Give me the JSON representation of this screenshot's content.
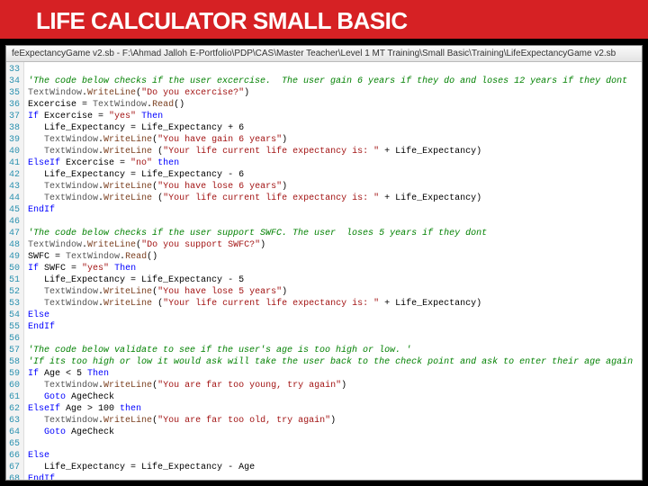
{
  "title": "LIFE CALCULATOR SMALL BASIC",
  "window_title": "feExpectancyGame v2.sb - F:\\Ahmad Jalloh E-Portfolio\\PDP\\CAS\\Master Teacher\\Level 1 MT Training\\Small Basic\\Training\\LifeExpectancyGame v2.sb",
  "lines": [
    {
      "n": "33",
      "t": []
    },
    {
      "n": "34",
      "t": [
        {
          "c": "tok-com",
          "v": "'The code below checks if the user excercise.  The user gain 6 years if they do and loses 12 years if they dont"
        }
      ]
    },
    {
      "n": "35",
      "t": [
        {
          "c": "tok-obj",
          "v": "TextWindow"
        },
        {
          "c": "tok-op",
          "v": "."
        },
        {
          "c": "tok-meth",
          "v": "WriteLine"
        },
        {
          "c": "tok-op",
          "v": "("
        },
        {
          "c": "tok-str",
          "v": "\"Do you excercise?\""
        },
        {
          "c": "tok-op",
          "v": ")"
        }
      ]
    },
    {
      "n": "36",
      "t": [
        {
          "c": "tok-var",
          "v": "Excercise "
        },
        {
          "c": "tok-op",
          "v": "= "
        },
        {
          "c": "tok-obj",
          "v": "TextWindow"
        },
        {
          "c": "tok-op",
          "v": "."
        },
        {
          "c": "tok-meth",
          "v": "Read"
        },
        {
          "c": "tok-op",
          "v": "()"
        }
      ]
    },
    {
      "n": "37",
      "t": [
        {
          "c": "tok-kw",
          "v": "If "
        },
        {
          "c": "tok-var",
          "v": "Excercise "
        },
        {
          "c": "tok-op",
          "v": "= "
        },
        {
          "c": "tok-str",
          "v": "\"yes\" "
        },
        {
          "c": "tok-kw",
          "v": "Then"
        }
      ]
    },
    {
      "n": "38",
      "t": [
        {
          "c": "tok-op",
          "v": "   "
        },
        {
          "c": "tok-var",
          "v": "Life_Expectancy "
        },
        {
          "c": "tok-op",
          "v": "= "
        },
        {
          "c": "tok-var",
          "v": "Life_Expectancy "
        },
        {
          "c": "tok-op",
          "v": "+ 6"
        }
      ]
    },
    {
      "n": "39",
      "t": [
        {
          "c": "tok-op",
          "v": "   "
        },
        {
          "c": "tok-obj",
          "v": "TextWindow"
        },
        {
          "c": "tok-op",
          "v": "."
        },
        {
          "c": "tok-meth",
          "v": "WriteLine"
        },
        {
          "c": "tok-op",
          "v": "("
        },
        {
          "c": "tok-str",
          "v": "\"You have gain 6 years\""
        },
        {
          "c": "tok-op",
          "v": ")"
        }
      ]
    },
    {
      "n": "40",
      "t": [
        {
          "c": "tok-op",
          "v": "   "
        },
        {
          "c": "tok-obj",
          "v": "TextWindow"
        },
        {
          "c": "tok-op",
          "v": "."
        },
        {
          "c": "tok-meth",
          "v": "WriteLine "
        },
        {
          "c": "tok-op",
          "v": "("
        },
        {
          "c": "tok-str",
          "v": "\"Your life current life expectancy is: \" "
        },
        {
          "c": "tok-op",
          "v": "+ "
        },
        {
          "c": "tok-var",
          "v": "Life_Expectancy"
        },
        {
          "c": "tok-op",
          "v": ")"
        }
      ]
    },
    {
      "n": "41",
      "t": [
        {
          "c": "tok-kw",
          "v": "ElseIf "
        },
        {
          "c": "tok-var",
          "v": "Excercise "
        },
        {
          "c": "tok-op",
          "v": "= "
        },
        {
          "c": "tok-str",
          "v": "\"no\" "
        },
        {
          "c": "tok-kw",
          "v": "then"
        }
      ]
    },
    {
      "n": "42",
      "t": [
        {
          "c": "tok-op",
          "v": "   "
        },
        {
          "c": "tok-var",
          "v": "Life_Expectancy "
        },
        {
          "c": "tok-op",
          "v": "= "
        },
        {
          "c": "tok-var",
          "v": "Life_Expectancy "
        },
        {
          "c": "tok-op",
          "v": "- 6"
        }
      ]
    },
    {
      "n": "43",
      "t": [
        {
          "c": "tok-op",
          "v": "   "
        },
        {
          "c": "tok-obj",
          "v": "TextWindow"
        },
        {
          "c": "tok-op",
          "v": "."
        },
        {
          "c": "tok-meth",
          "v": "WriteLine"
        },
        {
          "c": "tok-op",
          "v": "("
        },
        {
          "c": "tok-str",
          "v": "\"You have lose 6 years\""
        },
        {
          "c": "tok-op",
          "v": ")"
        }
      ]
    },
    {
      "n": "44",
      "t": [
        {
          "c": "tok-op",
          "v": "   "
        },
        {
          "c": "tok-obj",
          "v": "TextWindow"
        },
        {
          "c": "tok-op",
          "v": "."
        },
        {
          "c": "tok-meth",
          "v": "WriteLine "
        },
        {
          "c": "tok-op",
          "v": "("
        },
        {
          "c": "tok-str",
          "v": "\"Your life current life expectancy is: \" "
        },
        {
          "c": "tok-op",
          "v": "+ "
        },
        {
          "c": "tok-var",
          "v": "Life_Expectancy"
        },
        {
          "c": "tok-op",
          "v": ")"
        }
      ]
    },
    {
      "n": "45",
      "t": [
        {
          "c": "tok-kw",
          "v": "EndIf"
        }
      ]
    },
    {
      "n": "46",
      "t": []
    },
    {
      "n": "47",
      "t": [
        {
          "c": "tok-com",
          "v": "'The code below checks if the user support SWFC. The user  loses 5 years if they dont"
        }
      ]
    },
    {
      "n": "48",
      "t": [
        {
          "c": "tok-obj",
          "v": "TextWindow"
        },
        {
          "c": "tok-op",
          "v": "."
        },
        {
          "c": "tok-meth",
          "v": "WriteLine"
        },
        {
          "c": "tok-op",
          "v": "("
        },
        {
          "c": "tok-str",
          "v": "\"Do you support SWFC?\""
        },
        {
          "c": "tok-op",
          "v": ")"
        }
      ]
    },
    {
      "n": "49",
      "t": [
        {
          "c": "tok-var",
          "v": "SWFC "
        },
        {
          "c": "tok-op",
          "v": "= "
        },
        {
          "c": "tok-obj",
          "v": "TextWindow"
        },
        {
          "c": "tok-op",
          "v": "."
        },
        {
          "c": "tok-meth",
          "v": "Read"
        },
        {
          "c": "tok-op",
          "v": "()"
        }
      ]
    },
    {
      "n": "50",
      "t": [
        {
          "c": "tok-kw",
          "v": "If "
        },
        {
          "c": "tok-var",
          "v": "SWFC "
        },
        {
          "c": "tok-op",
          "v": "= "
        },
        {
          "c": "tok-str",
          "v": "\"yes\" "
        },
        {
          "c": "tok-kw",
          "v": "Then"
        }
      ]
    },
    {
      "n": "51",
      "t": [
        {
          "c": "tok-op",
          "v": "   "
        },
        {
          "c": "tok-var",
          "v": "Life_Expectancy "
        },
        {
          "c": "tok-op",
          "v": "= "
        },
        {
          "c": "tok-var",
          "v": "Life_Expectancy "
        },
        {
          "c": "tok-op",
          "v": "- 5"
        }
      ]
    },
    {
      "n": "52",
      "t": [
        {
          "c": "tok-op",
          "v": "   "
        },
        {
          "c": "tok-obj",
          "v": "TextWindow"
        },
        {
          "c": "tok-op",
          "v": "."
        },
        {
          "c": "tok-meth",
          "v": "WriteLine"
        },
        {
          "c": "tok-op",
          "v": "("
        },
        {
          "c": "tok-str",
          "v": "\"You have lose 5 years\""
        },
        {
          "c": "tok-op",
          "v": ")"
        }
      ]
    },
    {
      "n": "53",
      "t": [
        {
          "c": "tok-op",
          "v": "   "
        },
        {
          "c": "tok-obj",
          "v": "TextWindow"
        },
        {
          "c": "tok-op",
          "v": "."
        },
        {
          "c": "tok-meth",
          "v": "WriteLine "
        },
        {
          "c": "tok-op",
          "v": "("
        },
        {
          "c": "tok-str",
          "v": "\"Your life current life expectancy is: \" "
        },
        {
          "c": "tok-op",
          "v": "+ "
        },
        {
          "c": "tok-var",
          "v": "Life_Expectancy"
        },
        {
          "c": "tok-op",
          "v": ")"
        }
      ]
    },
    {
      "n": "54",
      "t": [
        {
          "c": "tok-kw",
          "v": "Else"
        }
      ]
    },
    {
      "n": "55",
      "t": [
        {
          "c": "tok-kw",
          "v": "EndIf"
        }
      ]
    },
    {
      "n": "56",
      "t": []
    },
    {
      "n": "57",
      "t": [
        {
          "c": "tok-com",
          "v": "'The code below validate to see if the user's age is too high or low. '"
        }
      ]
    },
    {
      "n": "58",
      "t": [
        {
          "c": "tok-com",
          "v": "'If its too high or low it would ask will take the user back to the check point and ask to enter their age again"
        }
      ]
    },
    {
      "n": "59",
      "t": [
        {
          "c": "tok-kw",
          "v": "If "
        },
        {
          "c": "tok-var",
          "v": "Age "
        },
        {
          "c": "tok-op",
          "v": "< 5 "
        },
        {
          "c": "tok-kw",
          "v": "Then"
        }
      ]
    },
    {
      "n": "60",
      "t": [
        {
          "c": "tok-op",
          "v": "   "
        },
        {
          "c": "tok-obj",
          "v": "TextWindow"
        },
        {
          "c": "tok-op",
          "v": "."
        },
        {
          "c": "tok-meth",
          "v": "WriteLine"
        },
        {
          "c": "tok-op",
          "v": "("
        },
        {
          "c": "tok-str",
          "v": "\"You are far too young, try again\""
        },
        {
          "c": "tok-op",
          "v": ")"
        }
      ]
    },
    {
      "n": "61",
      "t": [
        {
          "c": "tok-op",
          "v": "   "
        },
        {
          "c": "tok-kw",
          "v": "Goto "
        },
        {
          "c": "tok-var",
          "v": "AgeCheck"
        }
      ]
    },
    {
      "n": "62",
      "t": [
        {
          "c": "tok-kw",
          "v": "ElseIf "
        },
        {
          "c": "tok-var",
          "v": "Age "
        },
        {
          "c": "tok-op",
          "v": "> 100 "
        },
        {
          "c": "tok-kw",
          "v": "then"
        }
      ]
    },
    {
      "n": "63",
      "t": [
        {
          "c": "tok-op",
          "v": "   "
        },
        {
          "c": "tok-obj",
          "v": "TextWindow"
        },
        {
          "c": "tok-op",
          "v": "."
        },
        {
          "c": "tok-meth",
          "v": "WriteLine"
        },
        {
          "c": "tok-op",
          "v": "("
        },
        {
          "c": "tok-str",
          "v": "\"You are far too old, try again\""
        },
        {
          "c": "tok-op",
          "v": ")"
        }
      ]
    },
    {
      "n": "64",
      "t": [
        {
          "c": "tok-op",
          "v": "   "
        },
        {
          "c": "tok-kw",
          "v": "Goto "
        },
        {
          "c": "tok-var",
          "v": "AgeCheck"
        }
      ]
    },
    {
      "n": "65",
      "t": []
    },
    {
      "n": "66",
      "t": [
        {
          "c": "tok-kw",
          "v": "Else"
        }
      ]
    },
    {
      "n": "67",
      "t": [
        {
          "c": "tok-op",
          "v": "   "
        },
        {
          "c": "tok-var",
          "v": "Life_Expectancy "
        },
        {
          "c": "tok-op",
          "v": "= "
        },
        {
          "c": "tok-var",
          "v": "Life_Expectancy "
        },
        {
          "c": "tok-op",
          "v": "- "
        },
        {
          "c": "tok-var",
          "v": "Age"
        }
      ]
    },
    {
      "n": "68",
      "t": [
        {
          "c": "tok-kw",
          "v": "EndIf"
        }
      ]
    }
  ]
}
